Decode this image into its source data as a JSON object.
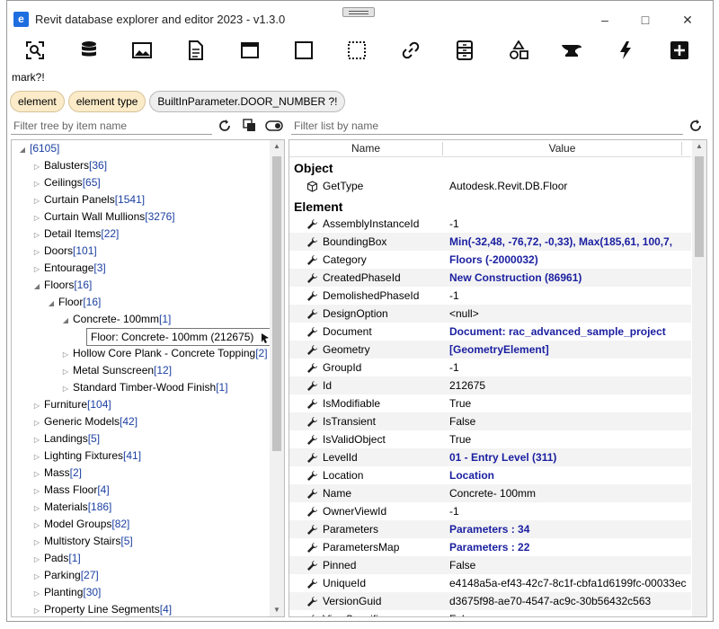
{
  "window": {
    "title": "Revit database explorer and editor 2023 - v1.3.0"
  },
  "icons": {
    "app": "app-icon",
    "minimize": "minimize-icon",
    "maximize": "maximize-icon",
    "close": "close-icon"
  },
  "toolbar": {
    "tools": [
      "snoop-selection-icon",
      "database-icon",
      "image-icon",
      "document-icon",
      "window-icon",
      "square-icon",
      "dashed-square-icon",
      "link-icon",
      "schema-icon",
      "shapes-icon",
      "anvil-icon",
      "lightning-icon",
      "add-icon"
    ]
  },
  "query": {
    "text": "mark?!"
  },
  "chips": [
    {
      "label": "element"
    },
    {
      "label": "element type"
    },
    {
      "label": "BuiltInParameter.DOOR_NUMBER ?!"
    }
  ],
  "tree_filter": {
    "placeholder": "Filter tree by item name"
  },
  "list_filter": {
    "placeholder": "Filter list by name"
  },
  "tree": {
    "root_count": "[6105]",
    "items": [
      {
        "label": "Balusters",
        "count": "[36]",
        "depth": 1,
        "state": "collapsed"
      },
      {
        "label": "Ceilings",
        "count": "[65]",
        "depth": 1,
        "state": "collapsed"
      },
      {
        "label": "Curtain Panels",
        "count": "[1541]",
        "depth": 1,
        "state": "collapsed"
      },
      {
        "label": "Curtain Wall Mullions",
        "count": "[3276]",
        "depth": 1,
        "state": "collapsed"
      },
      {
        "label": "Detail Items",
        "count": "[22]",
        "depth": 1,
        "state": "collapsed"
      },
      {
        "label": "Doors",
        "count": "[101]",
        "depth": 1,
        "state": "collapsed"
      },
      {
        "label": "Entourage",
        "count": "[3]",
        "depth": 1,
        "state": "collapsed"
      },
      {
        "label": "Floors",
        "count": "[16]",
        "depth": 1,
        "state": "expanded"
      },
      {
        "label": "Floor",
        "count": "[16]",
        "depth": 2,
        "state": "expanded"
      },
      {
        "label": "Concrete- 100mm",
        "count": "[1]",
        "depth": 3,
        "state": "expanded"
      },
      {
        "label": "",
        "count": "",
        "depth": 4,
        "state": "leaf"
      },
      {
        "label": "Hollow Core Plank - Concrete Topping",
        "count": "[2]",
        "depth": 3,
        "state": "collapsed"
      },
      {
        "label": "Metal Sunscreen",
        "count": "[12]",
        "depth": 3,
        "state": "collapsed"
      },
      {
        "label": "Standard Timber-Wood Finish",
        "count": "[1]",
        "depth": 3,
        "state": "collapsed"
      },
      {
        "label": "Furniture",
        "count": "[104]",
        "depth": 1,
        "state": "collapsed"
      },
      {
        "label": "Generic Models",
        "count": "[42]",
        "depth": 1,
        "state": "collapsed"
      },
      {
        "label": "Landings",
        "count": "[5]",
        "depth": 1,
        "state": "collapsed"
      },
      {
        "label": "Lighting Fixtures",
        "count": "[41]",
        "depth": 1,
        "state": "collapsed"
      },
      {
        "label": "Mass",
        "count": "[2]",
        "depth": 1,
        "state": "collapsed"
      },
      {
        "label": "Mass Floor",
        "count": "[4]",
        "depth": 1,
        "state": "collapsed"
      },
      {
        "label": "Materials",
        "count": "[186]",
        "depth": 1,
        "state": "collapsed"
      },
      {
        "label": "Model Groups",
        "count": "[82]",
        "depth": 1,
        "state": "collapsed"
      },
      {
        "label": "Multistory Stairs",
        "count": "[5]",
        "depth": 1,
        "state": "collapsed"
      },
      {
        "label": "Pads",
        "count": "[1]",
        "depth": 1,
        "state": "collapsed"
      },
      {
        "label": "Parking",
        "count": "[27]",
        "depth": 1,
        "state": "collapsed"
      },
      {
        "label": "Planting",
        "count": "[30]",
        "depth": 1,
        "state": "collapsed"
      },
      {
        "label": "Property Line Segments",
        "count": "[4]",
        "depth": 1,
        "state": "collapsed"
      }
    ],
    "tooltip": "Floor: Concrete- 100mm (212675)"
  },
  "props": {
    "col_name": "Name",
    "col_value": "Value",
    "section_object": "Object",
    "section_element": "Element",
    "object_rows": [
      {
        "name": "GetType",
        "value": "Autodesk.Revit.DB.Floor",
        "link": false,
        "icon": "cube-icon"
      }
    ],
    "element_rows": [
      {
        "name": "AssemblyInstanceId",
        "value": "-1",
        "link": false
      },
      {
        "name": "BoundingBox",
        "value": "Min(-32,48, -76,72, -0,33), Max(185,61, 100,7,",
        "link": true
      },
      {
        "name": "Category",
        "value": "Floors (-2000032)",
        "link": true
      },
      {
        "name": "CreatedPhaseId",
        "value": "New Construction (86961)",
        "link": true
      },
      {
        "name": "DemolishedPhaseId",
        "value": "-1",
        "link": false
      },
      {
        "name": "DesignOption",
        "value": "<null>",
        "link": false
      },
      {
        "name": "Document",
        "value": "Document: rac_advanced_sample_project",
        "link": true
      },
      {
        "name": "Geometry",
        "value": "[GeometryElement]",
        "link": true
      },
      {
        "name": "GroupId",
        "value": "-1",
        "link": false
      },
      {
        "name": "Id",
        "value": "212675",
        "link": false
      },
      {
        "name": "IsModifiable",
        "value": "True",
        "link": false
      },
      {
        "name": "IsTransient",
        "value": "False",
        "link": false
      },
      {
        "name": "IsValidObject",
        "value": "True",
        "link": false
      },
      {
        "name": "LevelId",
        "value": "01 - Entry Level (311)",
        "link": true
      },
      {
        "name": "Location",
        "value": "Location",
        "link": true
      },
      {
        "name": "Name",
        "value": "Concrete- 100mm",
        "link": false
      },
      {
        "name": "OwnerViewId",
        "value": "-1",
        "link": false
      },
      {
        "name": "Parameters",
        "value": "Parameters : 34",
        "link": true
      },
      {
        "name": "ParametersMap",
        "value": "Parameters : 22",
        "link": true
      },
      {
        "name": "Pinned",
        "value": "False",
        "link": false
      },
      {
        "name": "UniqueId",
        "value": "e4148a5a-ef43-42c7-8c1f-cbfa1d6199fc-00033ec",
        "link": false
      },
      {
        "name": "VersionGuid",
        "value": "d3675f98-ae70-4547-ac9c-30b56432c563",
        "link": false
      },
      {
        "name": "ViewSpecific",
        "value": "False",
        "link": false
      }
    ]
  }
}
